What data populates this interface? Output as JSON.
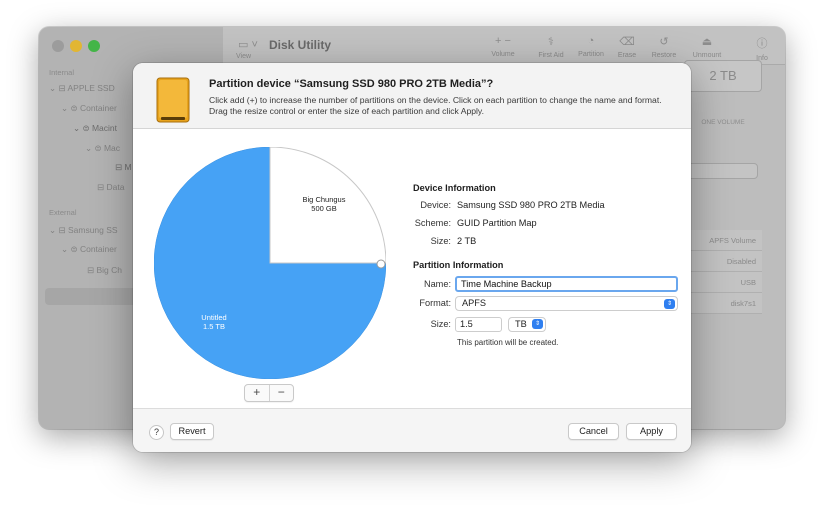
{
  "window": {
    "title": "Disk Utility",
    "view_label": "View",
    "toolbar": [
      {
        "label": "Volume",
        "icon": "plus-minus-icon",
        "glyph": "+  −"
      },
      {
        "label": "First Aid",
        "icon": "stethoscope-icon",
        "glyph": "⚕"
      },
      {
        "label": "Partition",
        "icon": "pie-chart-icon",
        "glyph": "◔"
      },
      {
        "label": "Erase",
        "icon": "erase-icon",
        "glyph": "⌫"
      },
      {
        "label": "Restore",
        "icon": "restore-icon",
        "glyph": "↺"
      },
      {
        "label": "Unmount",
        "icon": "eject-icon",
        "glyph": "⏏"
      },
      {
        "label": "Info",
        "icon": "info-icon",
        "glyph": "ⓘ"
      }
    ],
    "sidebar": {
      "internal_header": "Internal",
      "external_header": "External",
      "items": [
        {
          "label": "APPLE SSD"
        },
        {
          "label": "Container"
        },
        {
          "label": "Macint"
        },
        {
          "label": "Mac"
        },
        {
          "label": "M"
        },
        {
          "label": "Data"
        },
        {
          "label": "Samsung SS"
        },
        {
          "label": "Container"
        },
        {
          "label": "Big Ch"
        }
      ]
    },
    "right_panel": {
      "size": "2 TB",
      "size_caption": "ONE VOLUME",
      "rows": [
        "APFS Volume",
        "Disabled",
        "USB",
        "disk7s1"
      ]
    }
  },
  "sheet": {
    "title": "Partition device “Samsung SSD 980 PRO 2TB Media”?",
    "description": "Click add (+) to increase the number of partitions on the device. Click on each partition to change the name and format. Drag the resize control or enter the size of each partition and click Apply.",
    "pie": {
      "partitions": [
        {
          "name": "Big Chungus",
          "size": "500 GB",
          "fraction": 0.25,
          "color": "#ffffff"
        },
        {
          "name": "Untitled",
          "size": "1.5 TB",
          "fraction": 0.75,
          "color": "#46a2f5"
        }
      ]
    },
    "add_label": "+",
    "remove_label": "−",
    "device_info": {
      "title": "Device Information",
      "device_label": "Device:",
      "device_value": "Samsung SSD 980 PRO 2TB Media",
      "scheme_label": "Scheme:",
      "scheme_value": "GUID Partition Map",
      "size_label": "Size:",
      "size_value": "2 TB"
    },
    "partition_info": {
      "title": "Partition Information",
      "name_label": "Name:",
      "name_value": "Time Machine Backup",
      "format_label": "Format:",
      "format_value": "APFS",
      "size_label": "Size:",
      "size_value": "1.5",
      "unit_value": "TB",
      "note": "This partition will be created."
    },
    "footer": {
      "help": "?",
      "revert": "Revert",
      "cancel": "Cancel",
      "apply": "Apply"
    }
  }
}
